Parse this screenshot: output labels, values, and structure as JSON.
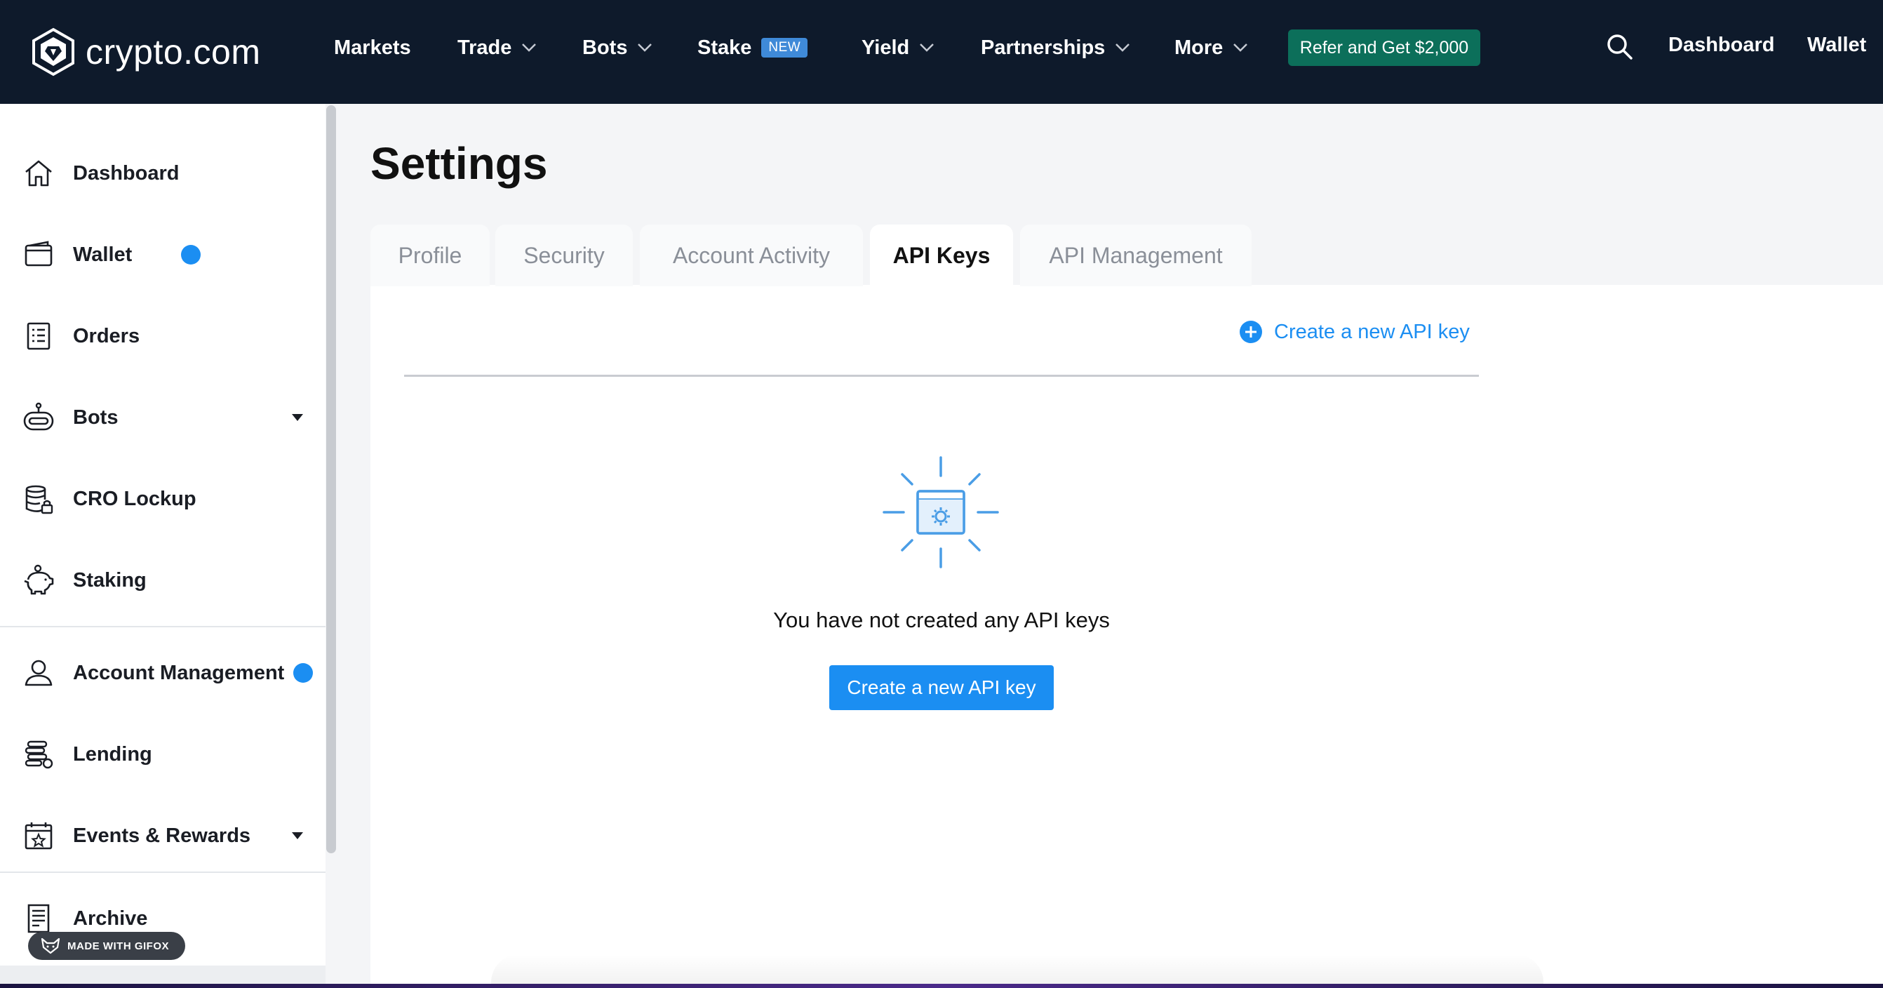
{
  "brand": {
    "name": "crypto.com"
  },
  "topnav": {
    "items": [
      {
        "label": "Markets"
      },
      {
        "label": "Trade"
      },
      {
        "label": "Bots"
      },
      {
        "label": "Stake",
        "badge": "NEW"
      },
      {
        "label": "Yield"
      },
      {
        "label": "Partnerships"
      },
      {
        "label": "More"
      }
    ],
    "refer_label": "Refer and Get $2,000",
    "dashboard_label": "Dashboard",
    "wallet_label": "Wallet",
    "icons": {
      "search": "search-icon",
      "chevron": "chevron-down-icon"
    }
  },
  "sidebar": {
    "items": [
      {
        "label": "Dashboard",
        "icon": "home-icon"
      },
      {
        "label": "Wallet",
        "icon": "wallet-icon"
      },
      {
        "label": "Orders",
        "icon": "orders-icon"
      },
      {
        "label": "Bots",
        "icon": "robot-icon"
      },
      {
        "label": "CRO Lockup",
        "icon": "lockup-icon"
      },
      {
        "label": "Staking",
        "icon": "piggy-bank-icon"
      },
      {
        "label": "Account Management",
        "icon": "account-icon"
      },
      {
        "label": "Lending",
        "icon": "lending-icon"
      },
      {
        "label": "Events & Rewards",
        "icon": "calendar-star-icon"
      },
      {
        "label": "Archive",
        "icon": "archive-icon"
      }
    ],
    "watermark": "MADE WITH GIFOX"
  },
  "main": {
    "title": "Settings",
    "tabs": [
      {
        "label": "Profile"
      },
      {
        "label": "Security"
      },
      {
        "label": "Account Activity"
      },
      {
        "label": "API Keys",
        "active": true
      },
      {
        "label": "API Management"
      }
    ],
    "create_link_label": "Create a new API key",
    "empty_state": {
      "message": "You have not created any API keys",
      "button_label": "Create a new API key",
      "icon": "api-settings-icon"
    }
  },
  "colors": {
    "nav_bg": "#0e1a2b",
    "accent": "#1b8ef2",
    "refer_bg": "#0c6f5a",
    "badge_bg": "#3f8ad8",
    "notification_dot": "#1b8ef2"
  }
}
